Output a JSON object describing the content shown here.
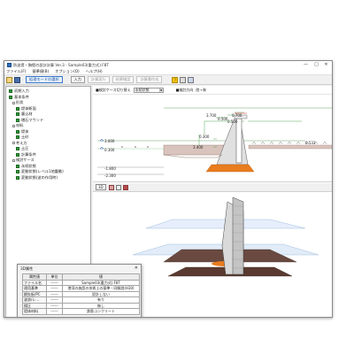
{
  "window": {
    "title": "防波堤・胸壁の設計計算 Ver.3 - Sample03(重力式).F8T",
    "minimize": "—",
    "maximize": "□",
    "close": "✕"
  },
  "menubar": [
    "ファイル(F)",
    "基準値(B)",
    "オプション(O)",
    "ヘルプ(H)"
  ],
  "toolbar": {
    "mode_button": "処理モードの選択",
    "buttons": [
      {
        "label": "入力",
        "state": "enabled"
      },
      {
        "label": "計算実行",
        "state": "disabled"
      },
      {
        "label": "結果確認",
        "state": "disabled"
      },
      {
        "label": "計算書作成",
        "state": "disabled"
      }
    ],
    "help_icon": "?"
  },
  "tree": [
    {
      "label": "初期入力",
      "level": 0,
      "icon": "green"
    },
    {
      "label": "基本条件",
      "level": 0,
      "icon": "green"
    },
    {
      "label": "形状",
      "level": 1,
      "icon": "none"
    },
    {
      "label": "堤体断面",
      "level": 2,
      "icon": "green"
    },
    {
      "label": "裏込材",
      "level": 2,
      "icon": "green"
    },
    {
      "label": "増石マウンド",
      "level": 2,
      "icon": "green"
    },
    {
      "label": "材料",
      "level": 1,
      "icon": "none"
    },
    {
      "label": "堤体",
      "level": 2,
      "icon": "green"
    },
    {
      "label": "土砂",
      "level": 2,
      "icon": "green"
    },
    {
      "label": "考え方",
      "level": 1,
      "icon": "none"
    },
    {
      "label": "土圧",
      "level": 2,
      "icon": "green"
    },
    {
      "label": "計算条件",
      "level": 2,
      "icon": "green"
    },
    {
      "label": "検討ケース",
      "level": 1,
      "icon": "none"
    },
    {
      "label": "永続状態",
      "level": 2,
      "icon": "green"
    },
    {
      "label": "変動状態(レベル1地震動)",
      "level": 2,
      "icon": "green"
    },
    {
      "label": "変動状態(波の作用時)",
      "level": 2,
      "icon": "green"
    }
  ],
  "case_bar": {
    "label": "■検討ケース切り替え",
    "selected": "永続状態",
    "direction_label": "■検討方向",
    "direction_value": "陸→海"
  },
  "section": {
    "dims": [
      "3.700",
      "0.500",
      "0.700",
      "0.500",
      "0.300",
      "3.400",
      "0.533"
    ],
    "levels": [
      "3.000",
      "0.300",
      "-1.800",
      "-2.300"
    ]
  },
  "view3d": {
    "button": "3D"
  },
  "properties": {
    "title": "3D属性",
    "close": "✕",
    "headers": [
      "属性値",
      "単位",
      "値"
    ],
    "rows": [
      {
        "name": "ファイル名",
        "unit": "------",
        "value": "Sample03(重力式).F8T"
      },
      {
        "name": "適用基準",
        "unit": "------",
        "value": "港湾の施設の技術上の基準・同解説(H30)"
      },
      {
        "name": "鋼矢板/PC",
        "unit": "------",
        "value": "設計しない"
      },
      {
        "name": "波浪/レ...",
        "unit": "------",
        "value": "有り"
      },
      {
        "name": "揚圧",
        "unit": "------",
        "value": "無し"
      },
      {
        "name": "堤体材料",
        "unit": "------",
        "value": "鉄筋コンクリート"
      }
    ]
  },
  "colors": {
    "accent": "#3a78c8",
    "status_ok": "#2f9a3a",
    "fill_soil": "#e87c1e"
  }
}
